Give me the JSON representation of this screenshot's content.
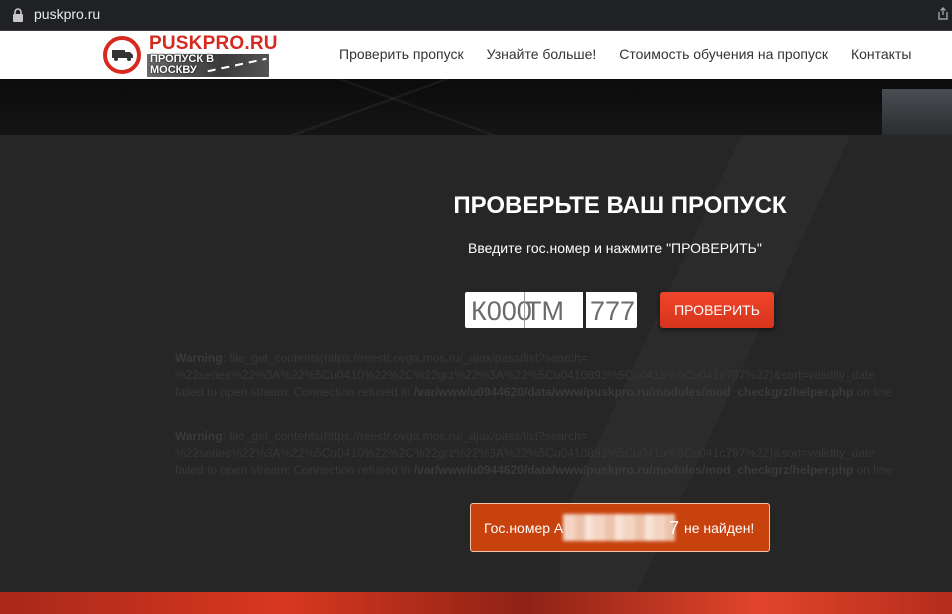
{
  "browser": {
    "url": "puskpro.ru"
  },
  "header": {
    "logo_brand": "PUSKPRO.RU",
    "logo_tagline": "ПРОПУСК В МОСКВУ",
    "nav": [
      {
        "label": "Проверить пропуск"
      },
      {
        "label": "Узнайте больше!"
      },
      {
        "label": "Стоимость обучения на пропуск"
      },
      {
        "label": "Контакты"
      }
    ]
  },
  "main": {
    "title": "ПРОВЕРЬТЕ ВАШ ПРОПУСК",
    "subtitle": "Введите гос.номер и нажмите \"ПРОВЕРИТЬ\"",
    "plate": {
      "letter1": "К000",
      "letters": "ТМ",
      "region": "777"
    },
    "check_button": "ПРОВЕРИТЬ",
    "warnings": [
      {
        "label": "Warning",
        "line1": ": file_get_contents(https://reestr.ovga.mos.ru/_ajax/pass/list?search=",
        "line2": "%22series%22%3A%22%5Cu0410%22%2C%22grz%22%3A%22%5Cu0410893%5Cu041a%5Cu041c797%22}&sort=validity_date",
        "line3_pre": "failed to open stream: Connection refused in ",
        "path": "/var/www/u0944620/data/www/puskpro.ru/modules/mod_checkgrz/helper.php",
        "line3_post": " on line"
      },
      {
        "label": "Warning",
        "line1": ": file_get_contents(https://reestr.ovga.mos.ru/_ajax/pass/list?search=",
        "line2": "%22series%22%3A%22%5Cu0410%22%2C%22grz%22%3A%22%5Cu0410893%5Cu041a%5Cu041c797%22}&sort=validity_date",
        "line3_pre": "failed to open stream: Connection refused in ",
        "path": "/var/www/u0944620/data/www/puskpro.ru/modules/mod_checkgrz/helper.php",
        "line3_post": " on line"
      }
    ],
    "result": {
      "prefix": "Гос.номер А",
      "last_digit": "7",
      "suffix": "не найден!"
    }
  },
  "colors": {
    "accent": "#e8402a",
    "result_bg": "#c8420e",
    "panel_bg": "#262626"
  }
}
